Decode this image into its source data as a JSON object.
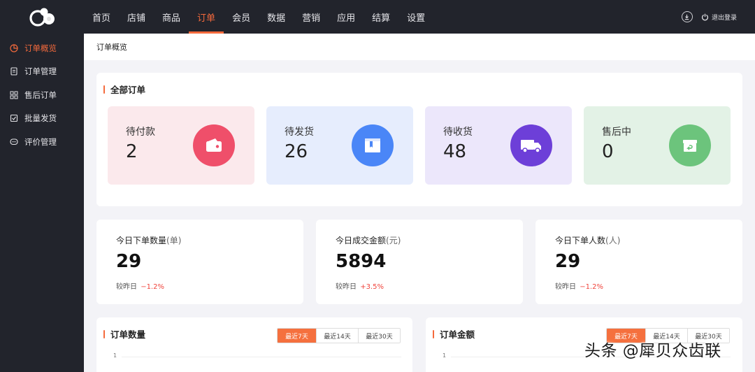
{
  "topnav": {
    "items": [
      {
        "label": "首页"
      },
      {
        "label": "店铺"
      },
      {
        "label": "商品"
      },
      {
        "label": "订单"
      },
      {
        "label": "会员"
      },
      {
        "label": "数据"
      },
      {
        "label": "营销"
      },
      {
        "label": "应用"
      },
      {
        "label": "结算"
      },
      {
        "label": "设置"
      }
    ],
    "active": "订单",
    "logout_label": "退出登录"
  },
  "sidebar": {
    "items": [
      {
        "label": "订单概览",
        "icon": "pie-chart-icon"
      },
      {
        "label": "订单管理",
        "icon": "document-icon"
      },
      {
        "label": "售后订单",
        "icon": "grid-icon"
      },
      {
        "label": "批量发货",
        "icon": "checklist-icon"
      },
      {
        "label": "评价管理",
        "icon": "comment-icon"
      }
    ],
    "active": "订单概览"
  },
  "page": {
    "title": "订单概览"
  },
  "all_orders": {
    "title": "全部订单",
    "tiles": [
      {
        "label": "待付款",
        "count": "2",
        "bg": "#fbe9ec",
        "circle": "#ef4f6a",
        "icon": "wallet-icon"
      },
      {
        "label": "待发货",
        "count": "26",
        "bg": "#e6edfd",
        "circle": "#4a86f7",
        "icon": "box-icon"
      },
      {
        "label": "待收货",
        "count": "48",
        "bg": "#ece7fb",
        "circle": "#6d3fd8",
        "icon": "truck-icon"
      },
      {
        "label": "售后中",
        "count": "0",
        "bg": "#e3f2e6",
        "circle": "#6cc47c",
        "icon": "return-box-icon"
      }
    ]
  },
  "stats": [
    {
      "label": "今日下单数量",
      "unit": "(单)",
      "value": "29",
      "compare_label": "较昨日",
      "delta": "−1.2%"
    },
    {
      "label": "今日成交金额",
      "unit": "(元)",
      "value": "5894",
      "compare_label": "较昨日",
      "delta": "+3.5%"
    },
    {
      "label": "今日下单人数",
      "unit": "(人)",
      "value": "29",
      "compare_label": "较昨日",
      "delta": "−1.2%"
    }
  ],
  "charts": [
    {
      "title": "订单数量",
      "ranges": [
        "最近7天",
        "最近14天",
        "最近30天"
      ],
      "active_range": "最近7天",
      "y_tick": "1"
    },
    {
      "title": "订单金额",
      "ranges": [
        "最近7天",
        "最近14天",
        "最近30天"
      ],
      "active_range": "最近7天",
      "y_tick": "1"
    }
  ],
  "watermark": "头条 @犀贝众齿联",
  "colors": {
    "accent": "#f56a3c",
    "topbar": "#22242c",
    "delta_negative": "#f0443c"
  }
}
